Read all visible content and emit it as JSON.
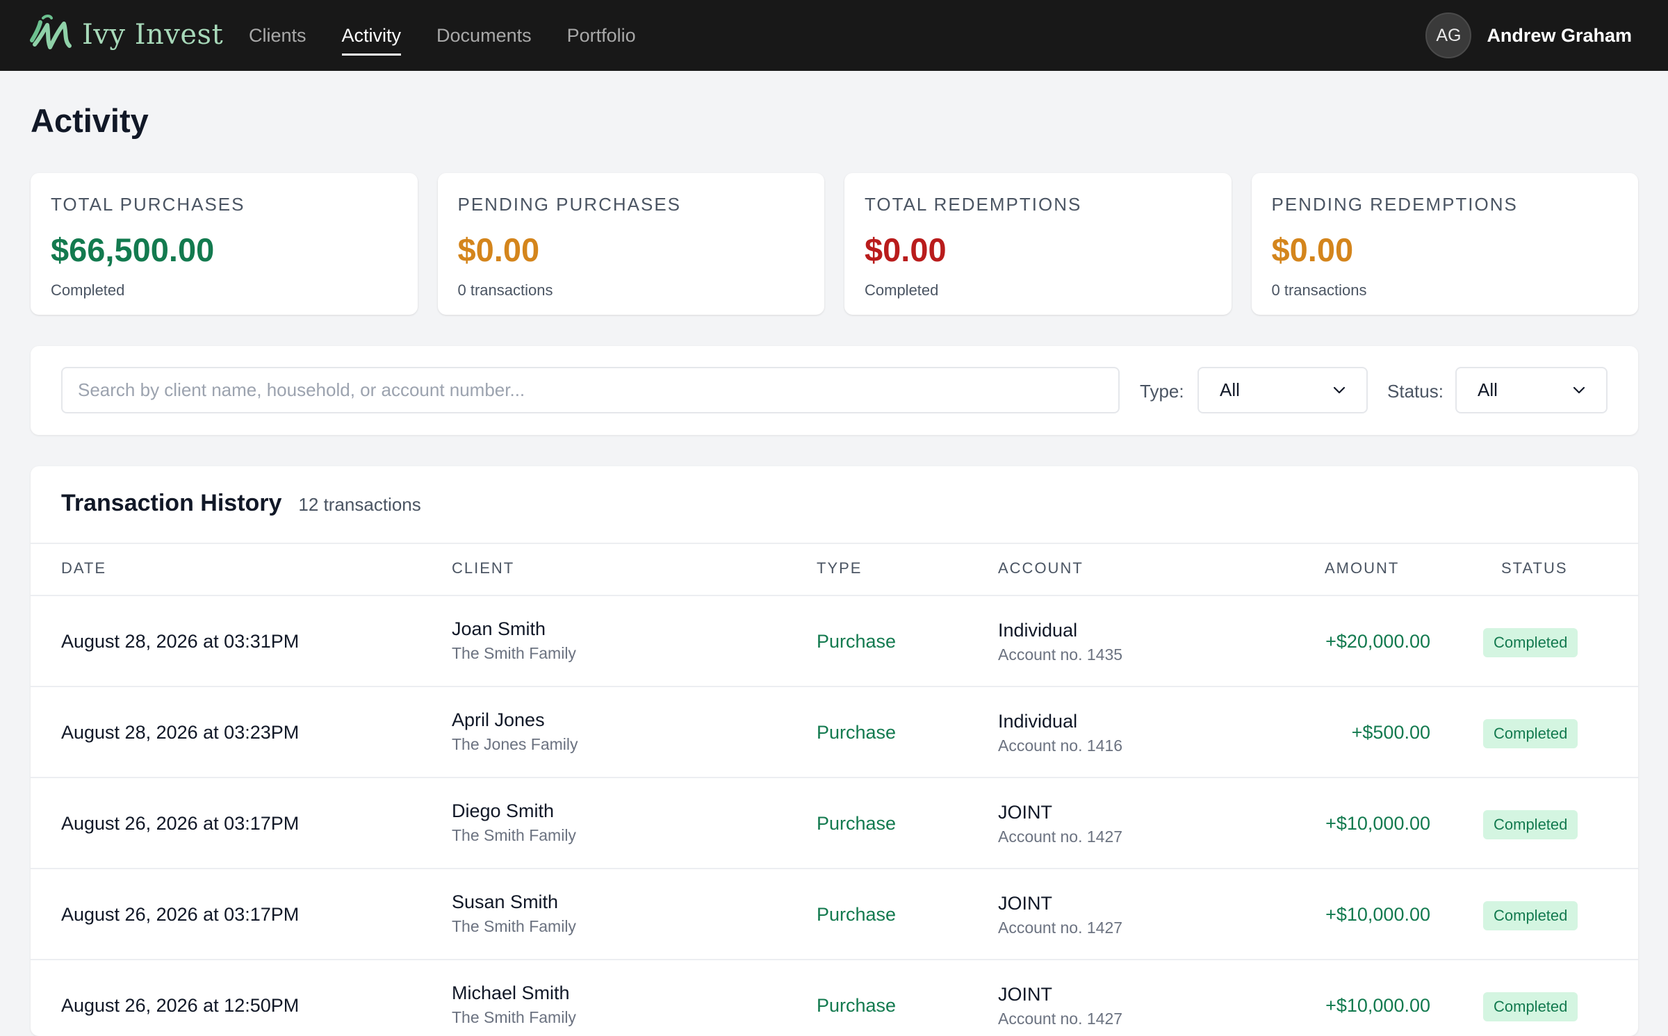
{
  "app": {
    "logo_text": "Ivy Invest",
    "nav": [
      "Clients",
      "Activity",
      "Documents",
      "Portfolio"
    ],
    "active_nav": "Activity",
    "user": {
      "initials": "AG",
      "name": "Andrew Graham"
    }
  },
  "page": {
    "title": "Activity"
  },
  "stats": [
    {
      "label": "TOTAL PURCHASES",
      "value": "$66,500.00",
      "sub": "Completed",
      "color": "#137a4f"
    },
    {
      "label": "PENDING PURCHASES",
      "value": "$0.00",
      "sub": "0 transactions",
      "color": "#d4851c"
    },
    {
      "label": "TOTAL REDEMPTIONS",
      "value": "$0.00",
      "sub": "Completed",
      "color": "#b91c1c"
    },
    {
      "label": "PENDING REDEMPTIONS",
      "value": "$0.00",
      "sub": "0 transactions",
      "color": "#d4851c"
    }
  ],
  "filters": {
    "search_placeholder": "Search by client name, household, or account number...",
    "search_value": "",
    "type_label": "Type:",
    "type_value": "All",
    "status_label": "Status:",
    "status_value": "All"
  },
  "table": {
    "title": "Transaction History",
    "count": "12 transactions",
    "columns": [
      "DATE",
      "CLIENT",
      "TYPE",
      "ACCOUNT",
      "AMOUNT",
      "STATUS"
    ],
    "rows": [
      {
        "date": "August 28, 2026 at 03:31PM",
        "client": "Joan Smith",
        "household": "The Smith Family",
        "type": "Purchase",
        "account": "Individual",
        "account_no": "Account no. 1435",
        "amount": "+$20,000.00",
        "status": "Completed"
      },
      {
        "date": "August 28, 2026 at 03:23PM",
        "client": "April Jones",
        "household": "The Jones Family",
        "type": "Purchase",
        "account": "Individual",
        "account_no": "Account no. 1416",
        "amount": "+$500.00",
        "status": "Completed"
      },
      {
        "date": "August 26, 2026 at 03:17PM",
        "client": "Diego Smith",
        "household": "The Smith Family",
        "type": "Purchase",
        "account": "JOINT",
        "account_no": "Account no. 1427",
        "amount": "+$10,000.00",
        "status": "Completed"
      },
      {
        "date": "August 26, 2026 at 03:17PM",
        "client": "Susan Smith",
        "household": "The Smith Family",
        "type": "Purchase",
        "account": "JOINT",
        "account_no": "Account no. 1427",
        "amount": "+$10,000.00",
        "status": "Completed"
      },
      {
        "date": "August 26, 2026 at 12:50PM",
        "client": "Michael Smith",
        "household": "The Smith Family",
        "type": "Purchase",
        "account": "JOINT",
        "account_no": "Account no. 1427",
        "amount": "+$10,000.00",
        "status": "Completed"
      }
    ]
  }
}
